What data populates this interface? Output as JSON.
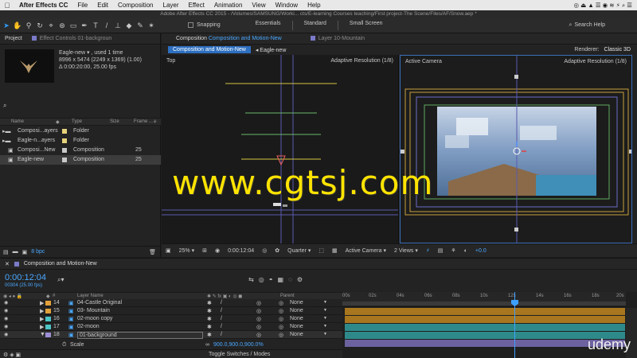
{
  "menubar": {
    "app": "After Effects CC",
    "items": [
      "File",
      "Edit",
      "Composition",
      "Layer",
      "Effect",
      "Animation",
      "View",
      "Window",
      "Help"
    ],
    "clock_area": "◎ ⏏ ▲ ☰ ◉ ≋ ⚡ ⌕ ☰"
  },
  "titlebar": "Adobe After Effects CC 2015 - /Volumes/SAMSUNG/Worki... cts/E-learning Courses teaching/First project-The Scene/Files/AF/Snow.aep *",
  "toolbar": {
    "snapping": "Snapping",
    "workspaces": [
      "Essentials",
      "Standard",
      "Small Screen"
    ],
    "search_help": "Search Help"
  },
  "project": {
    "tab_project": "Project",
    "tab_effects": "Effect Controls 01-backgroun",
    "info_name": "Eagle-new ▾ , used 1 time",
    "info_size": "8996 x 5474  (2249 x 1369) (1.00)",
    "info_duration": "Δ 0:00:20:00, 25.00 fps",
    "search_icon": "⌕",
    "col_name": "Name",
    "col_type": "Type",
    "col_size": "Size",
    "col_frame": "Frame ...",
    "rows": [
      {
        "name": "Composi...ayers",
        "type": "Folder",
        "fps": "",
        "color": "#e6d27a"
      },
      {
        "name": "Eagle-n...ayers",
        "type": "Folder",
        "fps": "",
        "color": "#e6d27a"
      },
      {
        "name": "Composi...New",
        "type": "Composition",
        "fps": "25",
        "color": "#c9c9c9"
      },
      {
        "name": "Eagle-new",
        "type": "Composition",
        "fps": "25",
        "color": "#c9c9c9"
      }
    ],
    "bpc": "8 bpc"
  },
  "viewer": {
    "tab_prefix": "Composition",
    "tab_comp": "Composition and Motion-New",
    "tab_layer": "Layer 10-Mountain",
    "crumb_active": "Composition and Motion-New",
    "crumb_next": "Eagle-new",
    "renderer_label": "Renderer:",
    "renderer_value": "Classic 3D",
    "left_view_name": "Top",
    "left_view_res": "Adaptive Resolution (1/8)",
    "right_view_name": "Active Camera",
    "right_view_res": "Adaptive Resolution (1/8)",
    "zoom": "25%",
    "timecode": "0:00:12:04",
    "resolution": "Quarter",
    "camera": "Active Camera",
    "views": "2 Views",
    "exposure": "+0.0"
  },
  "watermark": "www.cgtsj.com",
  "timeline": {
    "tab": "Composition and Motion-New",
    "timecode": "0:00:12:04",
    "fps": "00304 (25.00 fps)",
    "col_layer": "Layer Name",
    "col_parent": "Parent",
    "layers": [
      {
        "num": "14",
        "name": "04-Castle Original",
        "color": "#e3a23b",
        "parent": "None"
      },
      {
        "num": "15",
        "name": "03- Mountain",
        "color": "#e3a23b",
        "parent": "None"
      },
      {
        "num": "16",
        "name": "02-moon copy",
        "color": "#4ec5c5",
        "parent": "None"
      },
      {
        "num": "17",
        "name": "02-moon",
        "color": "#4ec5c5",
        "parent": "None"
      },
      {
        "num": "18",
        "name": "01-background",
        "color": "#9e8fd6",
        "parent": "None"
      }
    ],
    "scale_label": "Scale",
    "scale_value": "900.0,900.0,900.0%",
    "toggle": "Toggle Switches / Modes",
    "ruler": [
      "00s",
      "02s",
      "04s",
      "06s",
      "08s",
      "10s",
      "12s",
      "14s",
      "16s",
      "18s",
      "20s"
    ]
  },
  "brand": "udemy"
}
